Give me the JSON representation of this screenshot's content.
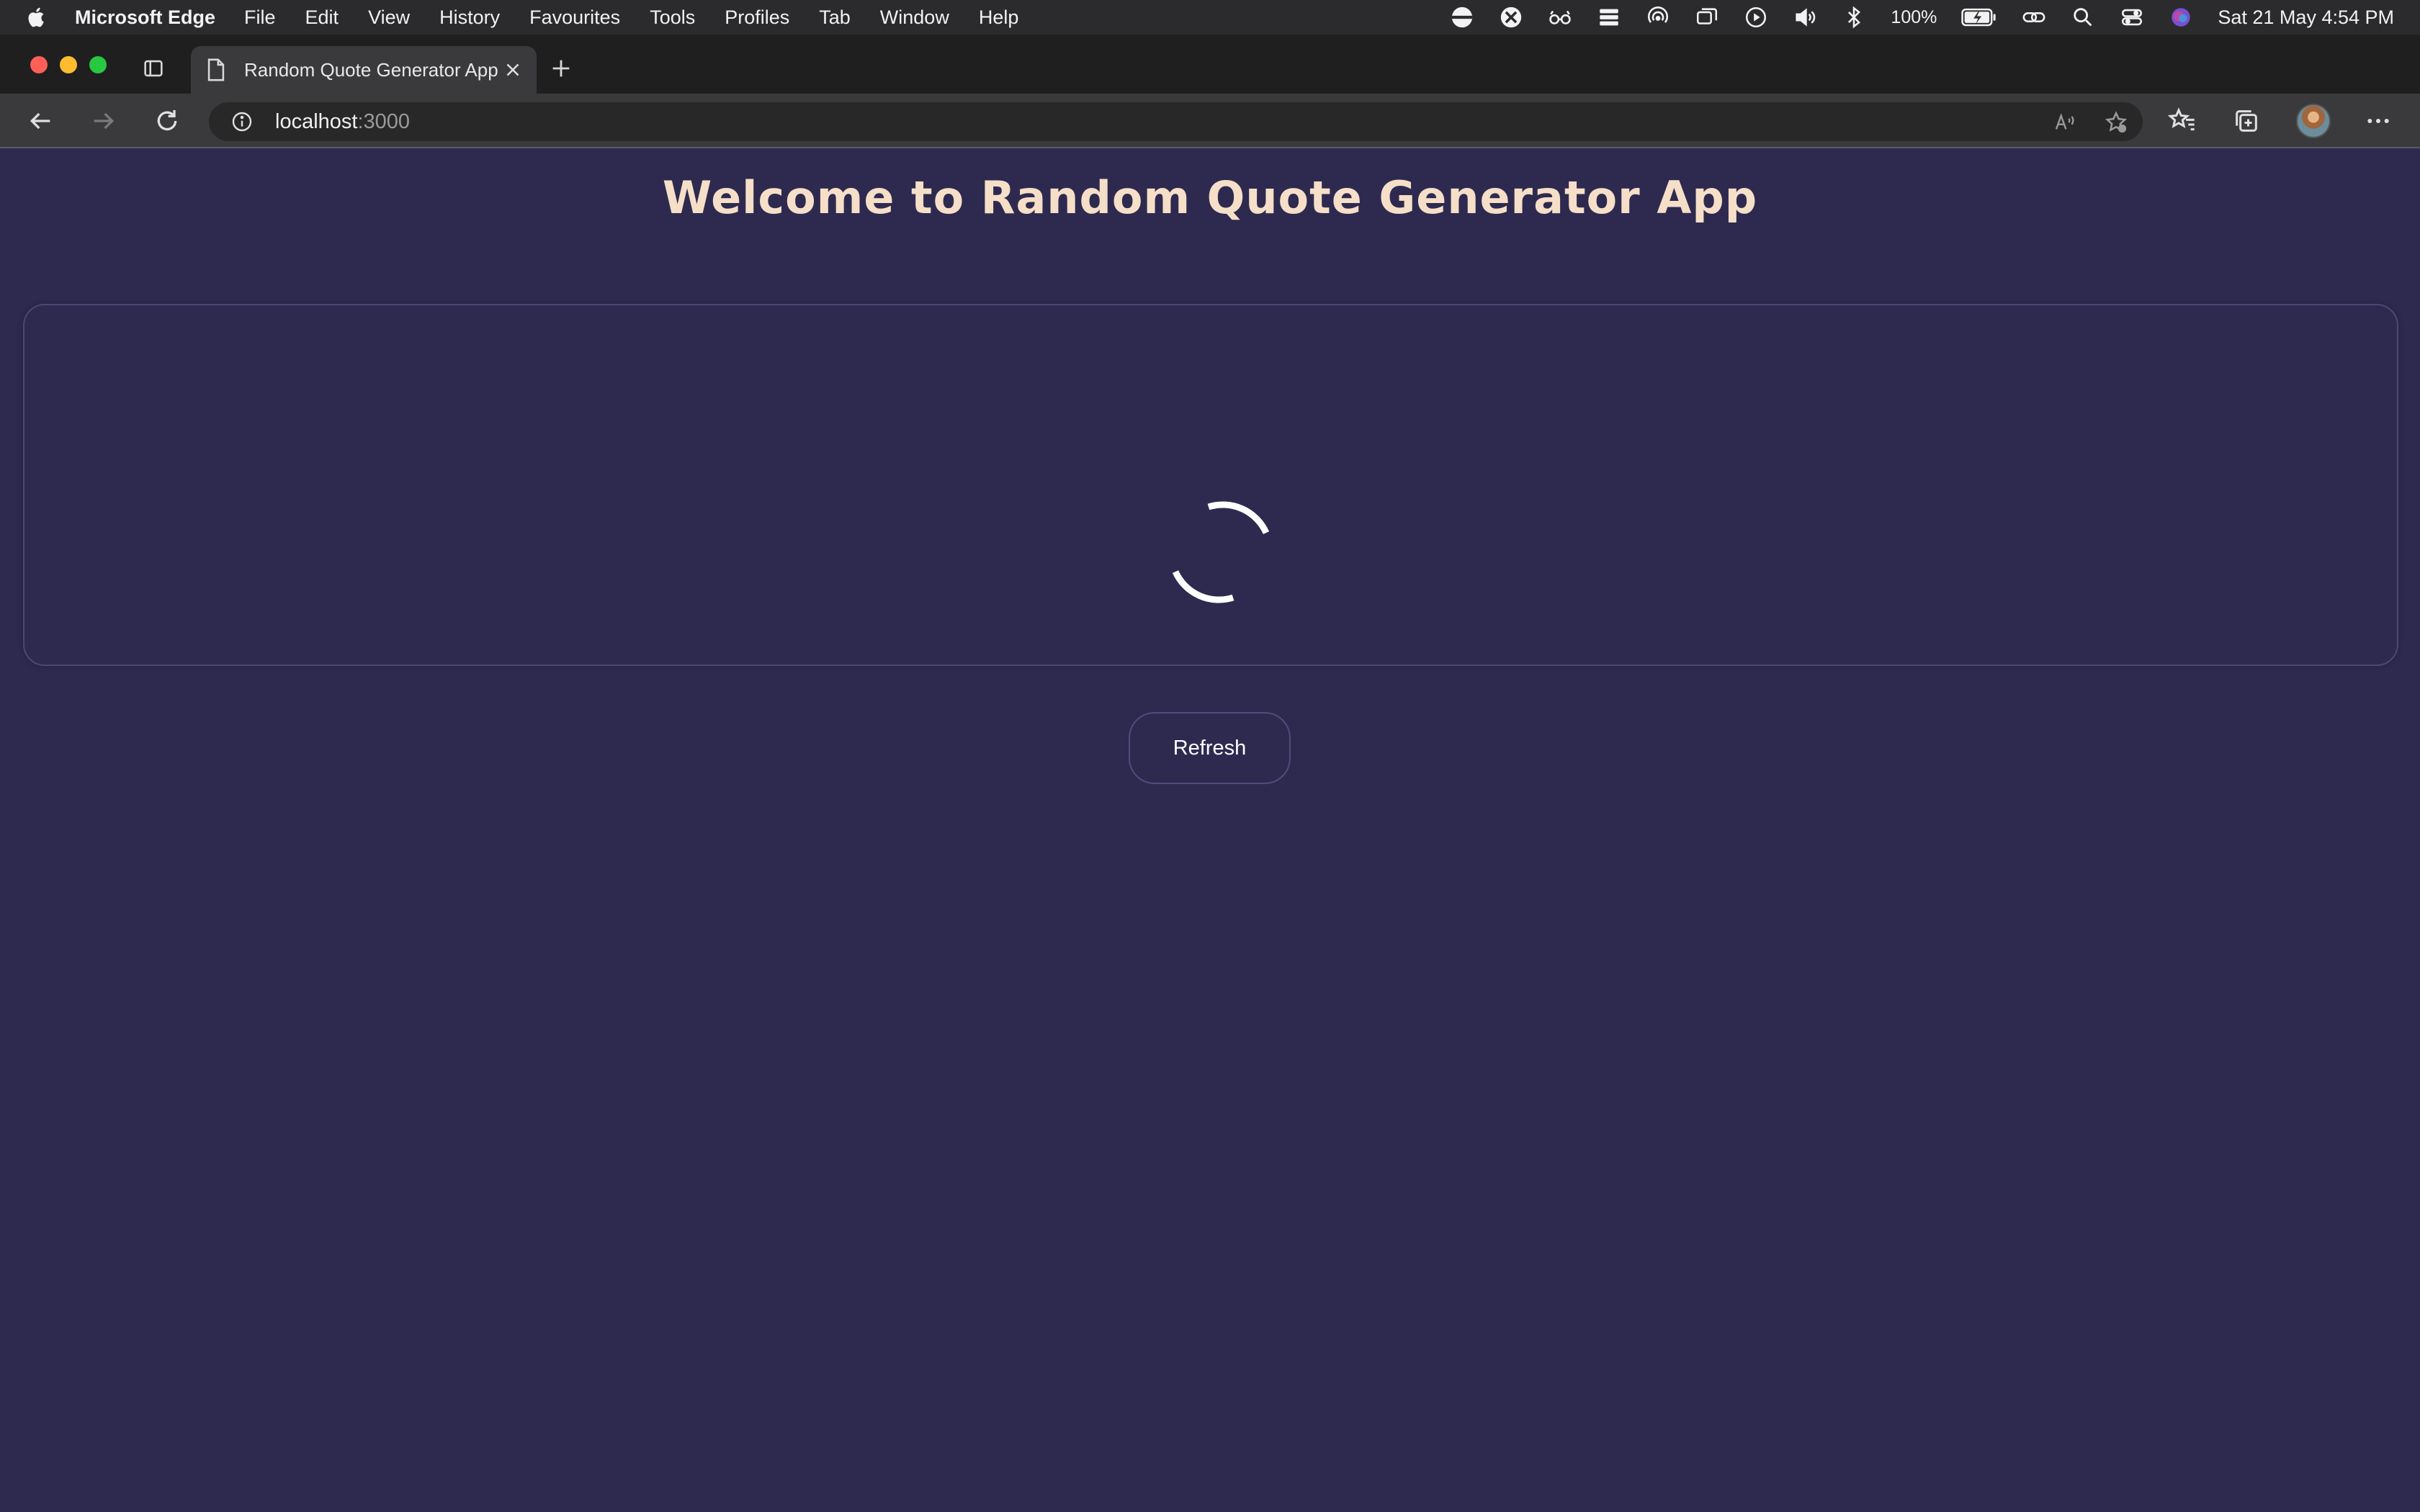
{
  "menubar": {
    "app_name": "Microsoft Edge",
    "items": [
      "File",
      "Edit",
      "View",
      "History",
      "Favourites",
      "Tools",
      "Profiles",
      "Tab",
      "Window",
      "Help"
    ],
    "battery": "100%",
    "clock": "Sat 21 May  4:54 PM"
  },
  "browser": {
    "tab_title": "Random Quote Generator App",
    "url_host": "localhost",
    "url_port": ":3000"
  },
  "page": {
    "title": "Welcome to Random Quote Generator App",
    "refresh_label": "Refresh",
    "loading": true
  },
  "colors": {
    "background": "#2e2a4f",
    "title": "#f6dfc8",
    "card_border": "#4a4775",
    "spinner": "#ffffff"
  }
}
